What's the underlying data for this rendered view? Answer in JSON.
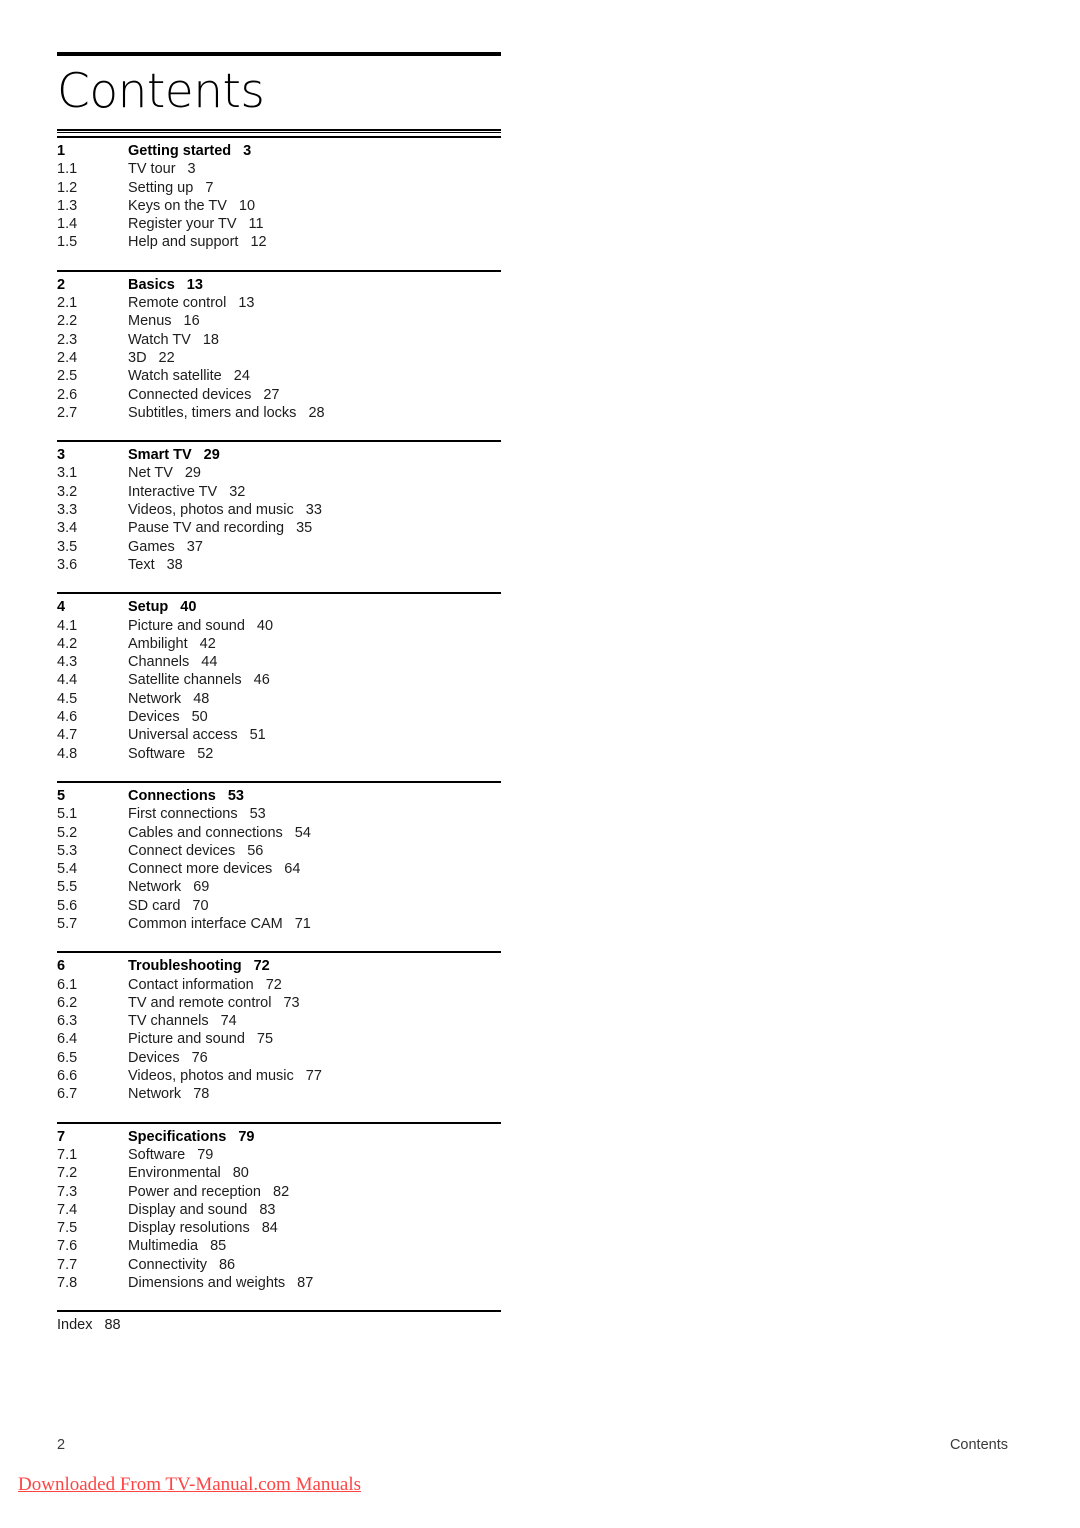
{
  "document": {
    "page_title": "Contents",
    "page_number": "2",
    "footer_label": "Contents"
  },
  "watermark": {
    "text": "Downloaded From TV-Manual.com Manuals",
    "color": "#ff4444"
  },
  "toc": {
    "sections": [
      {
        "number": "1",
        "title": "Getting started",
        "page": "3",
        "entries": [
          {
            "number": "1.1",
            "title": "TV tour",
            "page": "3"
          },
          {
            "number": "1.2",
            "title": "Setting up",
            "page": "7"
          },
          {
            "number": "1.3",
            "title": "Keys on the TV",
            "page": "10"
          },
          {
            "number": "1.4",
            "title": "Register your TV",
            "page": "11"
          },
          {
            "number": "1.5",
            "title": "Help and support",
            "page": "12"
          }
        ]
      },
      {
        "number": "2",
        "title": "Basics",
        "page": "13",
        "entries": [
          {
            "number": "2.1",
            "title": "Remote control",
            "page": "13"
          },
          {
            "number": "2.2",
            "title": "Menus",
            "page": "16"
          },
          {
            "number": "2.3",
            "title": "Watch TV",
            "page": "18"
          },
          {
            "number": "2.4",
            "title": "3D",
            "page": "22"
          },
          {
            "number": "2.5",
            "title": "Watch satellite",
            "page": "24"
          },
          {
            "number": "2.6",
            "title": "Connected devices",
            "page": "27"
          },
          {
            "number": "2.7",
            "title": "Subtitles, timers and locks",
            "page": "28"
          }
        ]
      },
      {
        "number": "3",
        "title": "Smart TV",
        "page": "29",
        "entries": [
          {
            "number": "3.1",
            "title": "Net TV",
            "page": "29"
          },
          {
            "number": "3.2",
            "title": "Interactive TV",
            "page": "32"
          },
          {
            "number": "3.3",
            "title": "Videos, photos and music",
            "page": "33"
          },
          {
            "number": "3.4",
            "title": "Pause TV and recording",
            "page": "35"
          },
          {
            "number": "3.5",
            "title": "Games",
            "page": "37"
          },
          {
            "number": "3.6",
            "title": "Text",
            "page": "38"
          }
        ]
      },
      {
        "number": "4",
        "title": "Setup",
        "page": "40",
        "entries": [
          {
            "number": "4.1",
            "title": "Picture and sound",
            "page": "40"
          },
          {
            "number": "4.2",
            "title": "Ambilight",
            "page": "42"
          },
          {
            "number": "4.3",
            "title": "Channels",
            "page": "44"
          },
          {
            "number": "4.4",
            "title": "Satellite channels",
            "page": "46"
          },
          {
            "number": "4.5",
            "title": "Network",
            "page": "48"
          },
          {
            "number": "4.6",
            "title": "Devices",
            "page": "50"
          },
          {
            "number": "4.7",
            "title": "Universal access",
            "page": "51"
          },
          {
            "number": "4.8",
            "title": "Software",
            "page": "52"
          }
        ]
      },
      {
        "number": "5",
        "title": "Connections",
        "page": "53",
        "entries": [
          {
            "number": "5.1",
            "title": "First connections",
            "page": "53"
          },
          {
            "number": "5.2",
            "title": "Cables and connections",
            "page": "54"
          },
          {
            "number": "5.3",
            "title": "Connect devices",
            "page": "56"
          },
          {
            "number": "5.4",
            "title": "Connect more devices",
            "page": "64"
          },
          {
            "number": "5.5",
            "title": "Network",
            "page": "69"
          },
          {
            "number": "5.6",
            "title": "SD card",
            "page": "70"
          },
          {
            "number": "5.7",
            "title": "Common interface CAM",
            "page": "71"
          }
        ]
      },
      {
        "number": "6",
        "title": "Troubleshooting",
        "page": "72",
        "entries": [
          {
            "number": "6.1",
            "title": "Contact information",
            "page": "72"
          },
          {
            "number": "6.2",
            "title": "TV and remote control",
            "page": "73"
          },
          {
            "number": "6.3",
            "title": "TV channels",
            "page": "74"
          },
          {
            "number": "6.4",
            "title": "Picture and sound",
            "page": "75"
          },
          {
            "number": "6.5",
            "title": "Devices",
            "page": "76"
          },
          {
            "number": "6.6",
            "title": "Videos, photos and music",
            "page": "77"
          },
          {
            "number": "6.7",
            "title": "Network",
            "page": "78"
          }
        ]
      },
      {
        "number": "7",
        "title": "Specifications",
        "page": "79",
        "entries": [
          {
            "number": "7.1",
            "title": "Software",
            "page": "79"
          },
          {
            "number": "7.2",
            "title": "Environmental",
            "page": "80"
          },
          {
            "number": "7.3",
            "title": "Power and reception",
            "page": "82"
          },
          {
            "number": "7.4",
            "title": "Display and sound",
            "page": "83"
          },
          {
            "number": "7.5",
            "title": "Display resolutions",
            "page": "84"
          },
          {
            "number": "7.6",
            "title": "Multimedia",
            "page": "85"
          },
          {
            "number": "7.7",
            "title": "Connectivity",
            "page": "86"
          },
          {
            "number": "7.8",
            "title": "Dimensions and weights",
            "page": "87"
          }
        ]
      }
    ],
    "index": {
      "label": "Index",
      "page": "88"
    }
  }
}
